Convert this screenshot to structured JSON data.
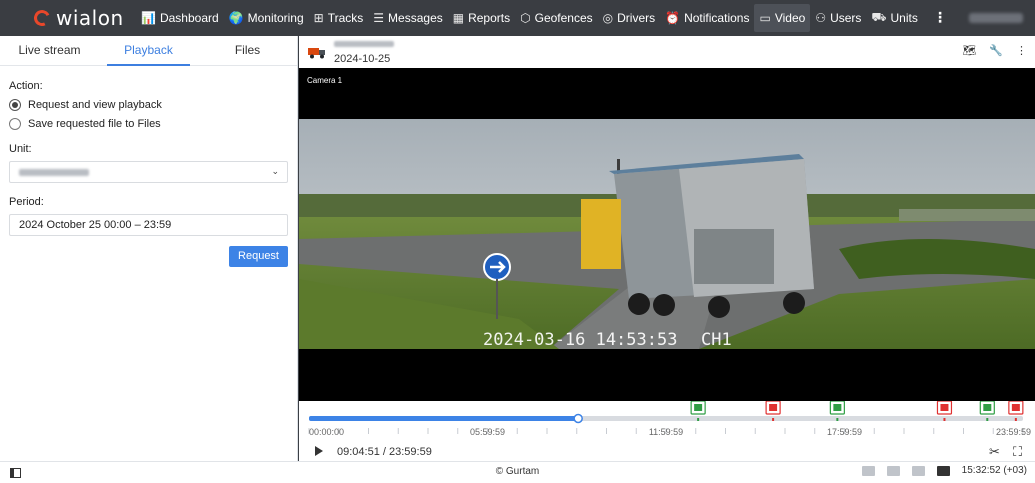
{
  "brand": {
    "logo_text": "wialon"
  },
  "nav": {
    "items": [
      {
        "label": "Dashboard",
        "icon": "bar-chart-icon",
        "glyph": "📊"
      },
      {
        "label": "Monitoring",
        "icon": "globe-icon",
        "glyph": "🌍"
      },
      {
        "label": "Tracks",
        "icon": "tracks-icon",
        "glyph": "⊞"
      },
      {
        "label": "Messages",
        "icon": "messages-icon",
        "glyph": "☰"
      },
      {
        "label": "Reports",
        "icon": "reports-icon",
        "glyph": "▦"
      },
      {
        "label": "Geofences",
        "icon": "geofence-icon",
        "glyph": "⬡"
      },
      {
        "label": "Drivers",
        "icon": "steering-wheel-icon",
        "glyph": "◎"
      },
      {
        "label": "Notifications",
        "icon": "alarm-clock-icon",
        "glyph": "⏰"
      },
      {
        "label": "Video",
        "icon": "video-camera-icon",
        "glyph": "▭"
      },
      {
        "label": "Users",
        "icon": "users-icon",
        "glyph": "⚇"
      },
      {
        "label": "Units",
        "icon": "car-icon",
        "glyph": "⛟"
      }
    ],
    "active": "Video"
  },
  "left_panel": {
    "tabs": [
      "Live stream",
      "Playback",
      "Files"
    ],
    "active_tab": "Playback",
    "action_label": "Action:",
    "options": [
      "Request and view playback",
      "Save requested file to Files"
    ],
    "selected_option": 0,
    "unit_label": "Unit:",
    "period_label": "Period:",
    "period_value": "2024 October 25 00:00 – 23:59",
    "request_button": "Request"
  },
  "viewer": {
    "date": "2024-10-25",
    "camera_label": "Camera 1",
    "overlay_timestamp": "2024-03-16 14:53:53",
    "overlay_channel": "CH1",
    "tools": [
      "map-icon",
      "wrench-icon",
      "kebab-menu-icon"
    ]
  },
  "timeline": {
    "tick_labels": [
      "00:00:00",
      "05:59:59",
      "11:59:59",
      "17:59:59",
      "23:59:59"
    ],
    "progress_fraction": 0.377,
    "current_time": "09:04:51",
    "total_time": "23:59:59",
    "time_display": "09:04:51 / 23:59:59",
    "events": [
      {
        "type": "green",
        "fraction": 0.545
      },
      {
        "type": "red",
        "fraction": 0.65
      },
      {
        "type": "green",
        "fraction": 0.74
      },
      {
        "type": "red",
        "fraction": 0.89
      },
      {
        "type": "green",
        "fraction": 0.95
      },
      {
        "type": "red",
        "fraction": 0.99
      }
    ],
    "colors": {
      "progress": "#3d83e6",
      "green": "#2f9e44",
      "red": "#e03131",
      "track": "#d8dbe0"
    }
  },
  "statusbar": {
    "copyright": "© Gurtam",
    "clock": "15:32:52 (+03)"
  }
}
